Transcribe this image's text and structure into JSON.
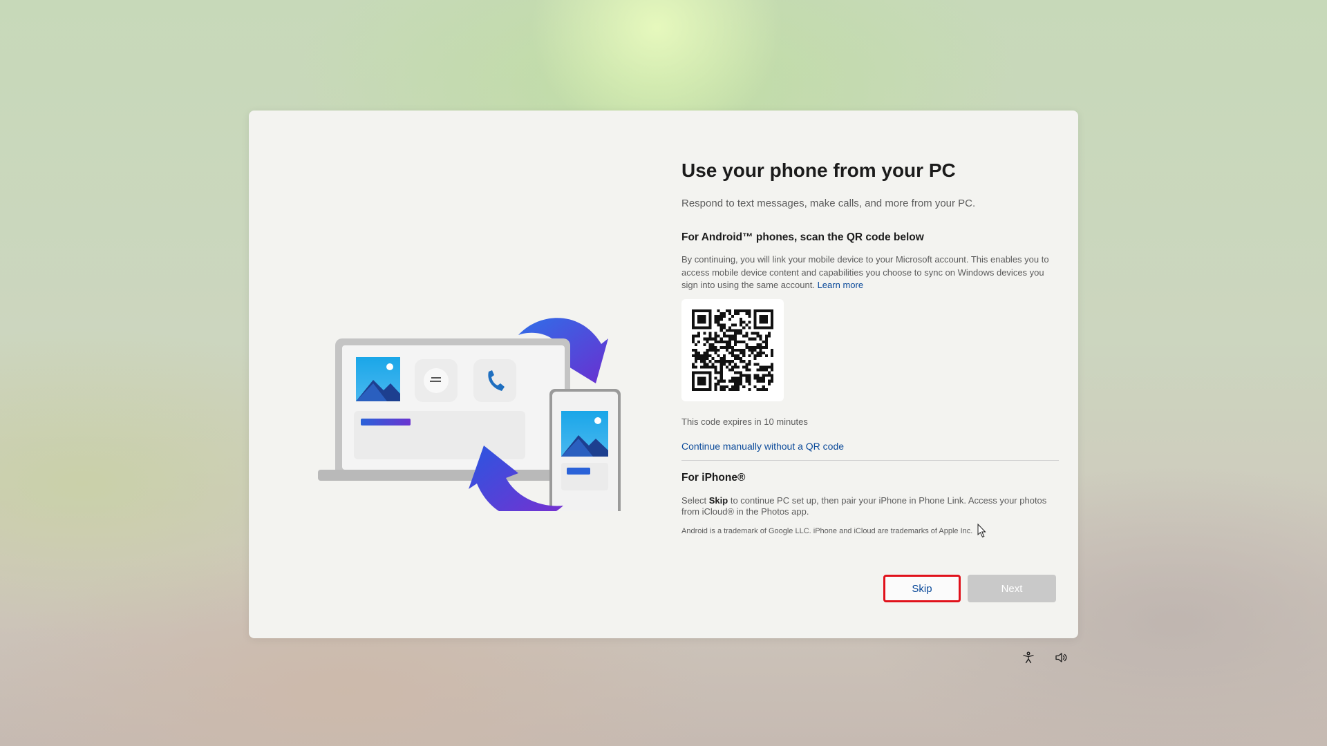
{
  "dialog": {
    "title": "Use your phone from your PC",
    "subtitle": "Respond to text messages, make calls, and more from your PC.",
    "android": {
      "heading": "For Android™ phones, scan the QR code below",
      "body": "By continuing, you will link your mobile device to your Microsoft account. This enables you to access mobile device content and capabilities you choose to sync on Windows devices you sign into using the same account.",
      "learn_more": "Learn more",
      "expires": "This code expires in 10 minutes",
      "manual_link": "Continue manually without a QR code"
    },
    "iphone": {
      "heading": "For iPhone®",
      "text_before": "Select ",
      "text_bold": "Skip",
      "text_after": " to continue PC set up, then pair your iPhone in Phone Link. Access your photos from iCloud® in the Photos app."
    },
    "trademark": "Android is a trademark of Google LLC. iPhone and iCloud are trademarks of Apple Inc.",
    "buttons": {
      "skip": "Skip",
      "next": "Next"
    }
  },
  "system_tray": {
    "icons": [
      "accessibility-icon",
      "volume-icon"
    ]
  },
  "colors": {
    "accent_blue": "#0b4a9a",
    "highlight_red": "#e0111b",
    "arrow_blue": "#3a4fd8",
    "arrow_purple": "#6a2fd0"
  }
}
